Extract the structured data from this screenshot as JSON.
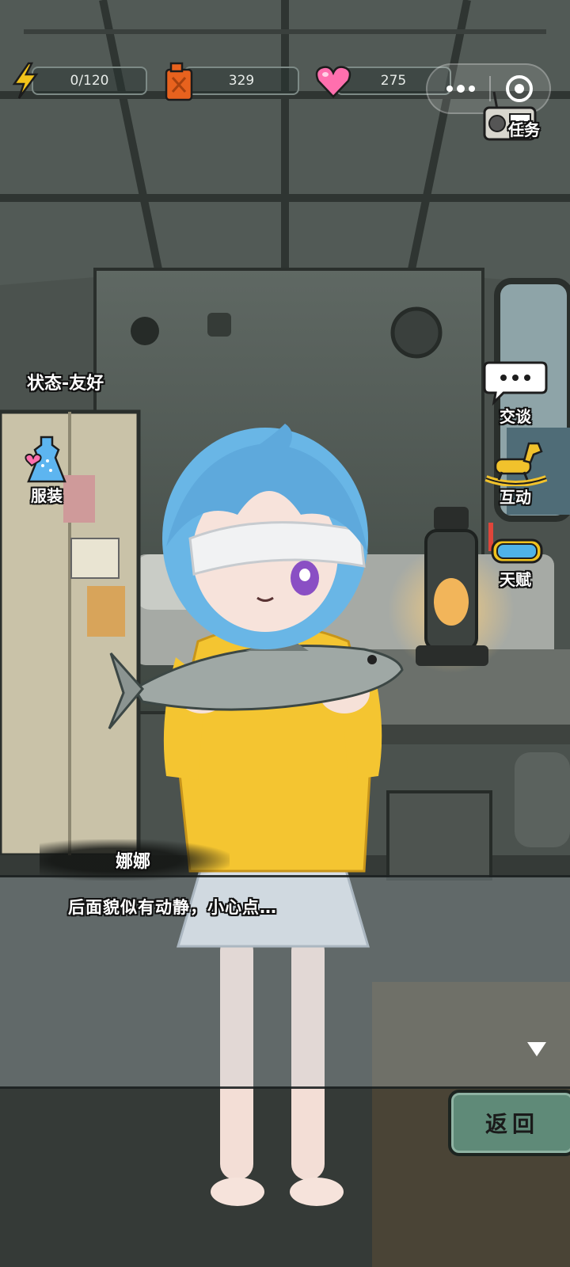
{
  "hud": {
    "energy": "0/120",
    "fuel": "329",
    "affection": "275"
  },
  "buttons": {
    "task": "任务",
    "talk": "交谈",
    "interact": "互动",
    "talent": "天赋",
    "outfit": "服装",
    "back": "返回"
  },
  "status": {
    "text": "状态-友好"
  },
  "dialog": {
    "speaker": "娜娜",
    "line": "后面貌似有动静，小心点…"
  },
  "colors": {
    "energy": "#f2c31a",
    "fuel": "#e8621e",
    "affection": "#ff6fae",
    "back_button": "#5f8a78"
  }
}
